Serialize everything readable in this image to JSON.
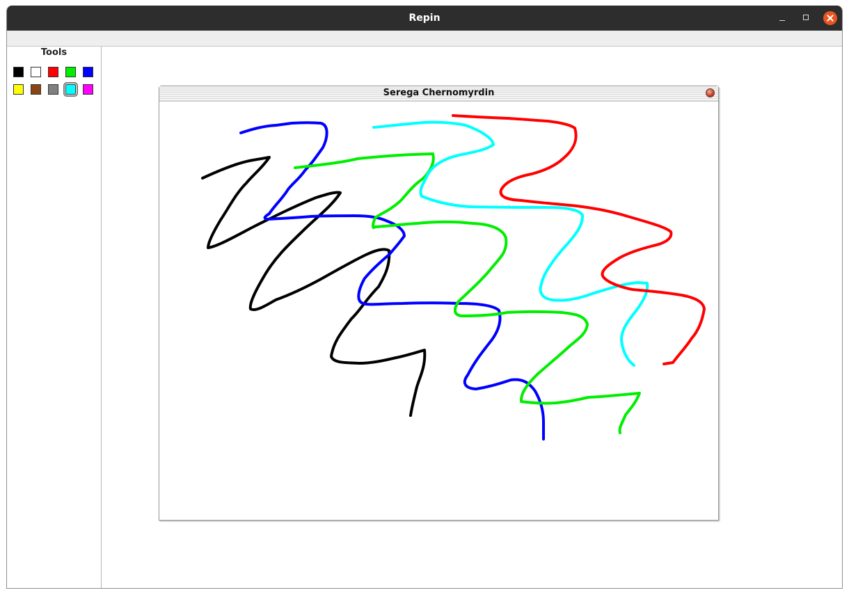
{
  "window": {
    "title": "Repin"
  },
  "tools": {
    "heading": "Tools",
    "palette": [
      {
        "name": "black",
        "color": "#000000",
        "selected": false
      },
      {
        "name": "white",
        "color": "#ffffff",
        "selected": false
      },
      {
        "name": "red",
        "color": "#ff0000",
        "selected": false
      },
      {
        "name": "green",
        "color": "#00ee00",
        "selected": false
      },
      {
        "name": "blue",
        "color": "#0000ff",
        "selected": false
      },
      {
        "name": "yellow",
        "color": "#ffff00",
        "selected": false
      },
      {
        "name": "brown",
        "color": "#8b4513",
        "selected": false
      },
      {
        "name": "gray",
        "color": "#808080",
        "selected": false
      },
      {
        "name": "cyan",
        "color": "#00ffff",
        "selected": true
      },
      {
        "name": "magenta",
        "color": "#ff00ff",
        "selected": false
      }
    ]
  },
  "canvas": {
    "title": "Serega Chernomyrdin",
    "strokes": [
      "black",
      "blue",
      "green",
      "cyan",
      "red"
    ]
  }
}
